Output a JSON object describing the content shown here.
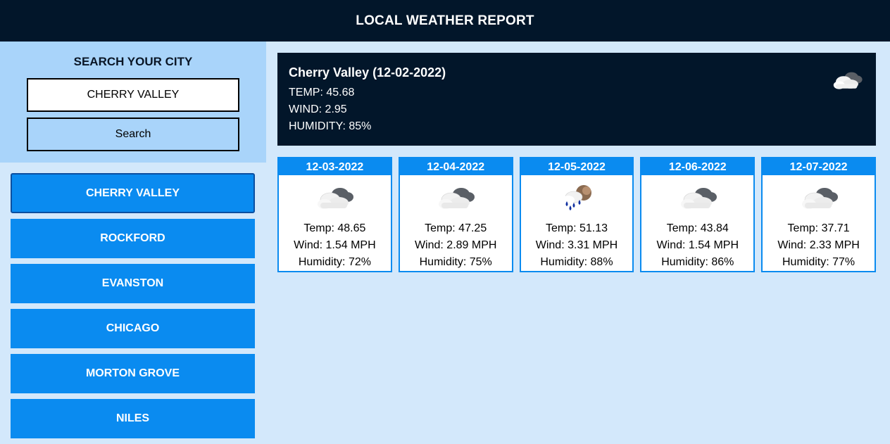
{
  "header": {
    "title": "LOCAL WEATHER REPORT"
  },
  "search": {
    "heading": "SEARCH YOUR CITY",
    "value": "CHERRY VALLEY",
    "button_label": "Search"
  },
  "cities": [
    {
      "label": "CHERRY VALLEY",
      "active": true
    },
    {
      "label": "ROCKFORD",
      "active": false
    },
    {
      "label": "EVANSTON",
      "active": false
    },
    {
      "label": "CHICAGO",
      "active": false
    },
    {
      "label": "MORTON GROVE",
      "active": false
    },
    {
      "label": "NILES",
      "active": false
    }
  ],
  "current": {
    "title": "Cherry Valley (12-02-2022)",
    "temp": "TEMP: 45.68",
    "wind": "WIND: 2.95",
    "humidity": "HUMIDITY: 85%",
    "icon": "broken-clouds-icon"
  },
  "forecast": [
    {
      "date": "12-03-2022",
      "icon": "broken-clouds-icon",
      "temp": "Temp: 48.65",
      "wind": "Wind: 1.54 MPH",
      "humidity": "Humidity: 72%"
    },
    {
      "date": "12-04-2022",
      "icon": "broken-clouds-icon",
      "temp": "Temp: 47.25",
      "wind": "Wind: 2.89 MPH",
      "humidity": "Humidity: 75%"
    },
    {
      "date": "12-05-2022",
      "icon": "rain-icon",
      "temp": "Temp: 51.13",
      "wind": "Wind: 3.31 MPH",
      "humidity": "Humidity: 88%"
    },
    {
      "date": "12-06-2022",
      "icon": "broken-clouds-icon",
      "temp": "Temp: 43.84",
      "wind": "Wind: 1.54 MPH",
      "humidity": "Humidity: 86%"
    },
    {
      "date": "12-07-2022",
      "icon": "broken-clouds-icon",
      "temp": "Temp: 37.71",
      "wind": "Wind: 2.33 MPH",
      "humidity": "Humidity: 77%"
    }
  ],
  "colors": {
    "header_bg": "#02162a",
    "page_bg": "#d3e8fb",
    "search_panel_bg": "#a9d4fa",
    "accent": "#0a8bf0"
  }
}
